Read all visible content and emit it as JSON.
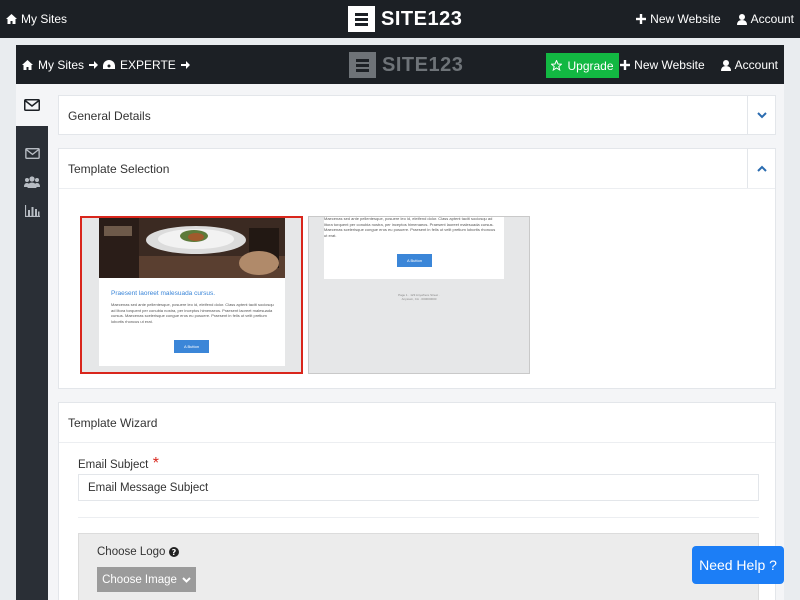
{
  "outer_bar": {
    "my_sites": "My Sites",
    "logo_text": "SITE123",
    "new_website": "New Website",
    "account": "Account"
  },
  "inner_bar": {
    "my_sites": "My Sites",
    "site_name": "EXPERTE",
    "logo_text": "SITE123",
    "upgrade": "Upgrade",
    "new_website": "New Website",
    "account": "Account"
  },
  "sidebar": {
    "items": [
      {
        "icon": "envelope-icon",
        "active": true
      },
      {
        "icon": "envelope-icon",
        "active": false
      },
      {
        "icon": "users-icon",
        "active": false
      },
      {
        "icon": "bar-chart-icon",
        "active": false
      }
    ]
  },
  "panels": {
    "general_details": "General Details",
    "template_selection": "Template Selection",
    "template_wizard": "Template Wizard"
  },
  "templates": [
    {
      "heading": "Praesent laoreet malesuada cursus.",
      "body": "Maecenas sed ante pellentesque, posuere leo id, eleifend dolor. Class aptent taciti sociosqu ad litora torquent per conubia nostra, per inceptos himenaeos. Praesent laoreet malesuada cursus. Maecenas scelerisque congue eros eu posuere. Praesent in felis ut velit pretium lobortis rhoncus ut erat.",
      "button": "A Button",
      "selected": true
    },
    {
      "body": "Maecenas sed ante pellentesque, posuere leo id, eleifend dolor. Class aptent taciti sociosqu ad litora torquent per conubia nostra, per inceptos himenaeos. Praesent laoreet malesuada cursus. Maecenas scelerisque congue eros eu posuere. Praesent in felis ut velit pretium lobortis rhoncus ut erat.",
      "button": "A Button",
      "footer": "Page 1 · 123 Anywhere Street · Anytown, CA · 000000000",
      "selected": false
    }
  ],
  "wizard": {
    "email_subject_label": "Email Subject",
    "required_mark": "*",
    "email_subject_value": "Email Message Subject",
    "choose_logo_label": "Choose Logo",
    "choose_image_button": "Choose Image"
  },
  "help": {
    "label": "Need Help ?"
  },
  "colors": {
    "dark_bar": "#1c2025",
    "upgrade_green": "#12b842",
    "accent_blue": "#1c7ef6",
    "selection_red": "#d9261c"
  }
}
